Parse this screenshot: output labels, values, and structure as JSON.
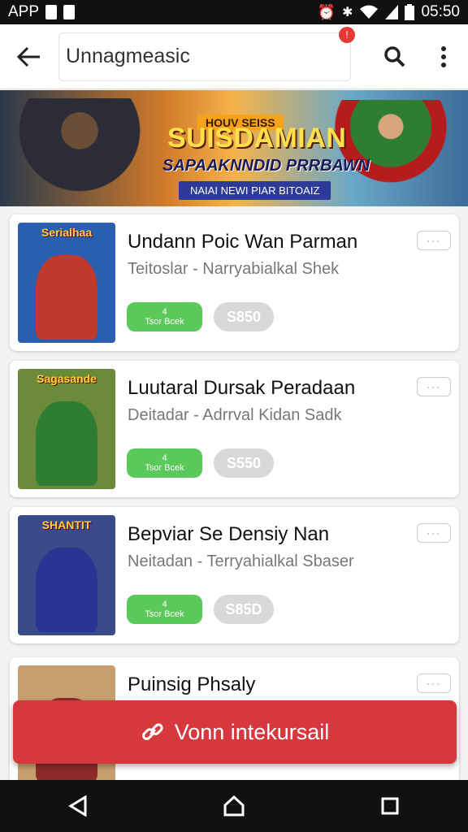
{
  "status_bar": {
    "left_text": "APP",
    "time": "05:50"
  },
  "toolbar": {
    "search_value": "Unnagmeasic",
    "notif_count": "!"
  },
  "banner": {
    "kicker": "HOUV SEISS",
    "title": "SUISDAMIAN",
    "subtitle": "SAPAAKNNDID PRRBAWN",
    "pill": "NAIAI NEWI PIAR BITOAIZ"
  },
  "games": [
    {
      "title": "Undann Poic Wan Parman",
      "subtitle": "Teitoslar - Narryabialkal Shek",
      "install_top": "4",
      "install_bottom": "Tsor Bcek",
      "price": "S850",
      "thumb_label": "Serialhaa",
      "thumb_bg": "#2a5fb0",
      "thumb_fig": "#c0392b"
    },
    {
      "title": "Luutaral Dursak Peradaan",
      "subtitle": "Deitadar - Adrrval Kidan Sadk",
      "install_top": "4",
      "install_bottom": "Tsor Bcek",
      "price": "S550",
      "thumb_label": "Sagasande",
      "thumb_bg": "#6b8a3a",
      "thumb_fig": "#2e7d32"
    },
    {
      "title": "Bepviar Se Densiy Nan",
      "subtitle": "Neitadan - Terryahialkal Sbaser",
      "install_top": "4",
      "install_bottom": "Tsor Bcek",
      "price": "S85D",
      "thumb_label": "SHANTIT",
      "thumb_bg": "#3a4a8a",
      "thumb_fig": "#283593"
    },
    {
      "title": "Puinsig Phsaly",
      "subtitle": "",
      "install_top": "",
      "install_bottom": "",
      "price": "",
      "thumb_label": "",
      "thumb_bg": "#c8a070",
      "thumb_fig": "#8d2a2a"
    }
  ],
  "fab": {
    "label": "Vonn intekursail"
  },
  "icons": {
    "back": "arrow-left-icon",
    "search": "search-icon",
    "more": "more-vert-icon",
    "fab": "link-icon"
  },
  "colors": {
    "fab": "#d7383d",
    "install": "#5ac95a",
    "price": "#d8d8d8"
  }
}
